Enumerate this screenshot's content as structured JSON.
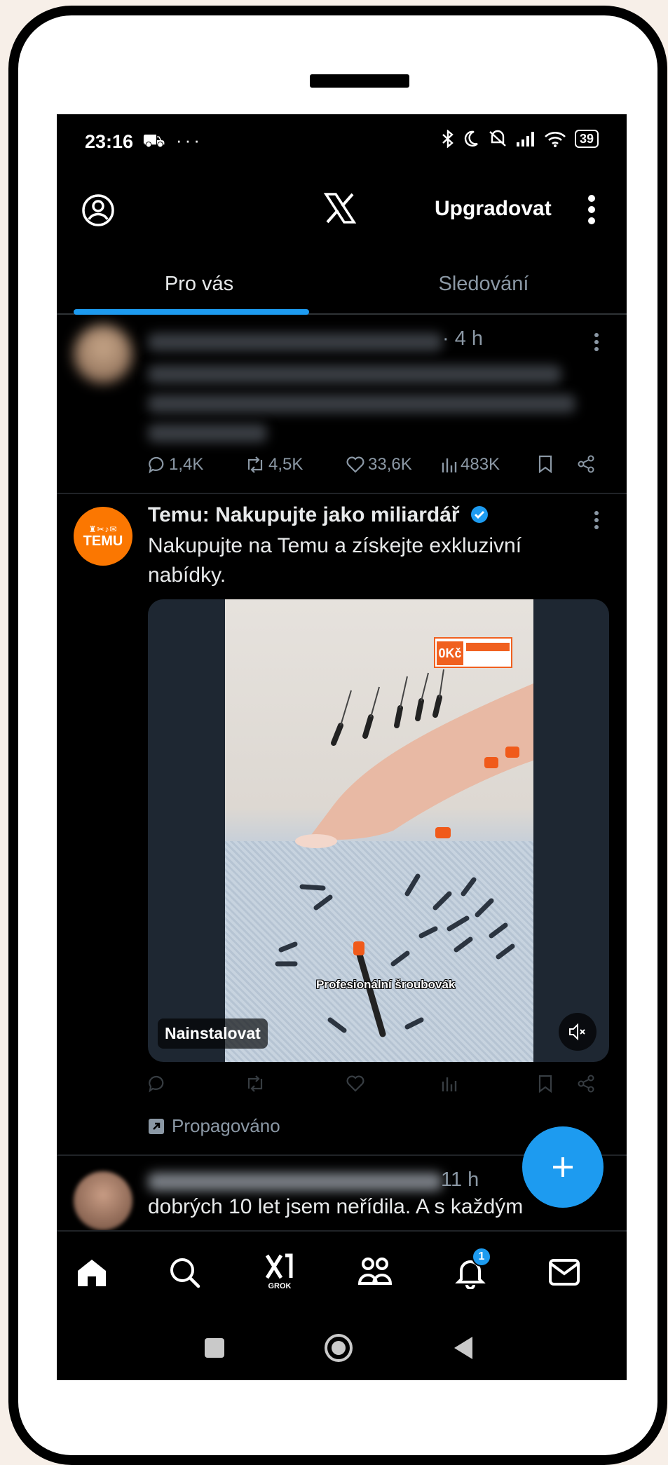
{
  "status_bar": {
    "time": "23:16",
    "left_icons": "⛟ ···",
    "battery": "39"
  },
  "header": {
    "upgrade_label": "Upgradovat"
  },
  "tabs": [
    {
      "label": "Pro vás",
      "active": true
    },
    {
      "label": "Sledování",
      "active": false
    }
  ],
  "post1": {
    "time": "· 4 h",
    "replies": "1,4K",
    "reposts": "4,5K",
    "likes": "33,6K",
    "views": "483K"
  },
  "ad_post": {
    "author": "Temu: Nakupujte jako miliardář",
    "text": "Nakupujte na Temu a získejte exkluzivní nabídky.",
    "logo_text": "TEMU",
    "video_caption": "Profesionální šroubovák",
    "badge_text": "0Kč",
    "install_label": "Nainstalovat",
    "promoted_label": "Propagováno"
  },
  "post3": {
    "time": "11 h",
    "text": "dobrých 10 let jsem neřídila. A s každým"
  },
  "bottom_nav": {
    "grok_label": "GROK",
    "notification_count": "1"
  },
  "colors": {
    "accent": "#1d9bf0",
    "background": "#000000",
    "muted": "#8b98a5",
    "temu": "#fb7701"
  }
}
